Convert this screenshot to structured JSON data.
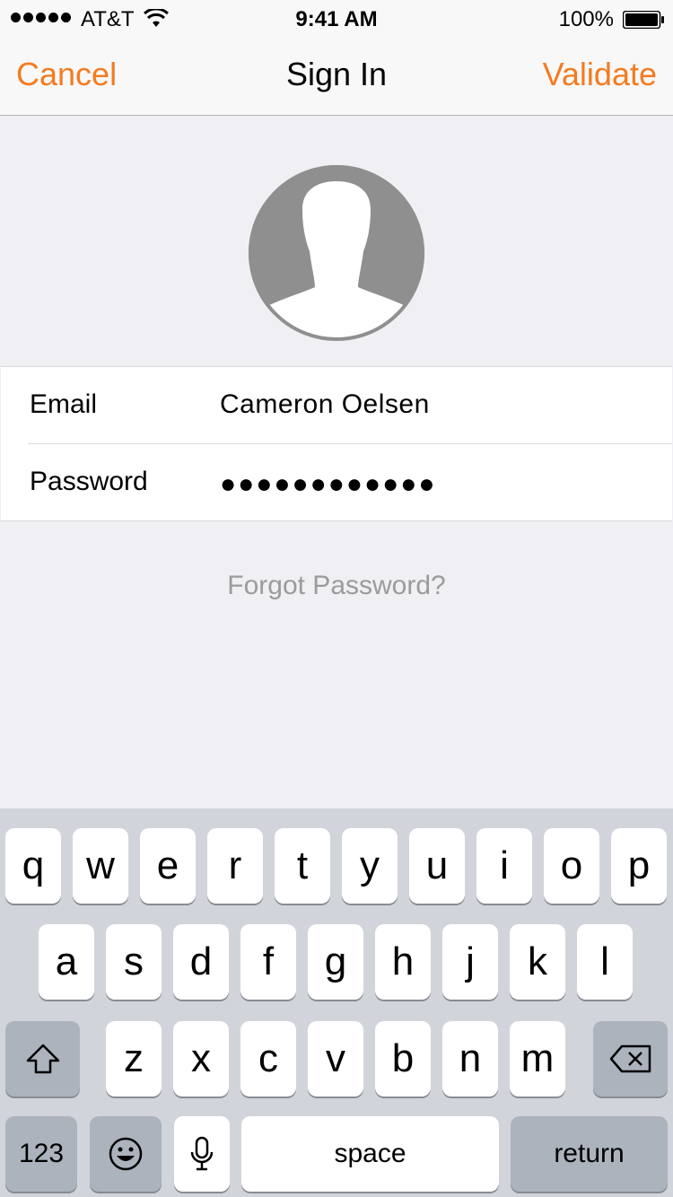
{
  "status_bar": {
    "carrier": "AT&T",
    "time": "9:41 AM",
    "battery": "100%"
  },
  "nav": {
    "cancel": "Cancel",
    "title": "Sign In",
    "validate": "Validate"
  },
  "form": {
    "email_label": "Email",
    "email_value": "Cameron Oelsen",
    "password_label": "Password",
    "password_value": "●●●●●●●●●●●●"
  },
  "forgot": "Forgot Password?",
  "keyboard": {
    "row1": [
      "q",
      "w",
      "e",
      "r",
      "t",
      "y",
      "u",
      "i",
      "o",
      "p"
    ],
    "row2": [
      "a",
      "s",
      "d",
      "f",
      "g",
      "h",
      "j",
      "k",
      "l"
    ],
    "row3": [
      "z",
      "x",
      "c",
      "v",
      "b",
      "n",
      "m"
    ],
    "numbers": "123",
    "space": "space",
    "return": "return"
  },
  "colors": {
    "accent": "#f47b20",
    "background": "#efeff4",
    "keyboard_bg": "#d1d5db",
    "avatar": "#8f8f8f"
  }
}
